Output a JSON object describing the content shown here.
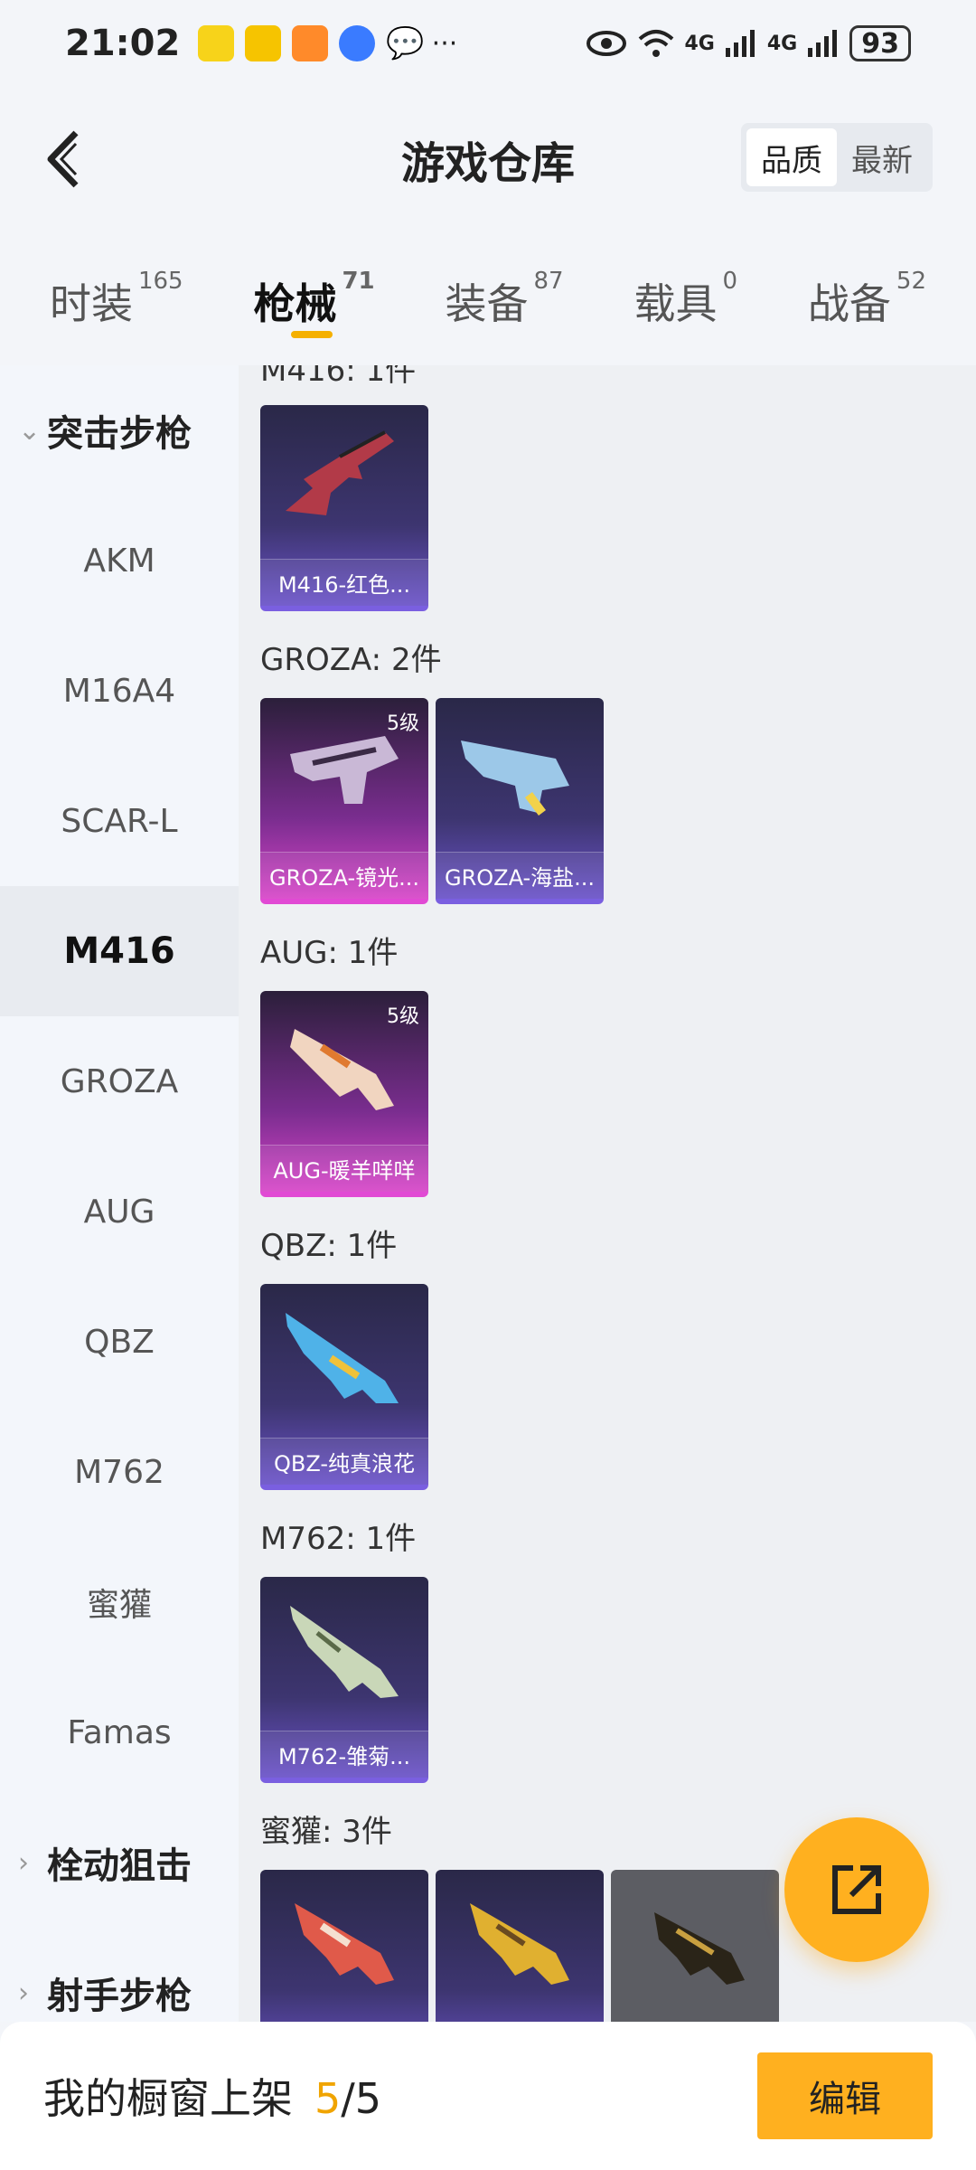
{
  "status_bar": {
    "time": "21:02",
    "network_1": "4G",
    "network_2": "4G",
    "battery": "93"
  },
  "header": {
    "title": "游戏仓库",
    "sort_options": [
      "品质",
      "最新"
    ],
    "sort_selected": "品质"
  },
  "tabs": [
    {
      "label": "时装",
      "count": "165"
    },
    {
      "label": "枪械",
      "count": "71",
      "active": true
    },
    {
      "label": "装备",
      "count": "87"
    },
    {
      "label": "载具",
      "count": "0"
    },
    {
      "label": "战备",
      "count": "52"
    }
  ],
  "sidebar": {
    "group_assault": "突击步枪",
    "items": [
      "AKM",
      "M16A4",
      "SCAR-L",
      "M416",
      "GROZA",
      "AUG",
      "QBZ",
      "M762",
      "蜜獾",
      "Famas"
    ],
    "active_item": "M416",
    "group_bolt": "栓动狙击",
    "group_marksman": "射手步枪"
  },
  "content": {
    "partial_section": "M416: 1件",
    "sections": [
      {
        "title": "GROZA: 2件"
      },
      {
        "title": "AUG: 1件"
      },
      {
        "title": "QBZ: 1件"
      },
      {
        "title": "M762: 1件"
      },
      {
        "title": "蜜獾: 3件"
      }
    ],
    "cards": {
      "m416": {
        "label": "M416-红色..."
      },
      "groza1": {
        "label": "GROZA-镜光...",
        "level": "5级"
      },
      "groza2": {
        "label": "GROZA-海盐..."
      },
      "aug1": {
        "label": "AUG-暖羊咩咩",
        "level": "5级"
      },
      "qbz1": {
        "label": "QBZ-纯真浪花"
      },
      "m762": {
        "label": "M762-雏菊..."
      }
    }
  },
  "bottom_bar": {
    "text": "我的橱窗上架",
    "current": "5",
    "total": "/5",
    "edit_label": "编辑"
  },
  "colors": {
    "accent": "#ffb01f",
    "accent_text": "#f0a400"
  }
}
